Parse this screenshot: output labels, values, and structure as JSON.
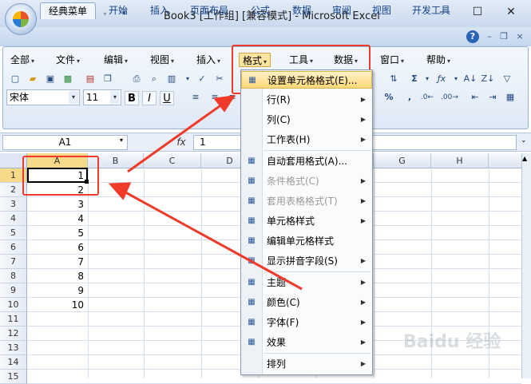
{
  "window": {
    "title": "Book3  [工作组]  [兼容模式] - Microsoft Excel"
  },
  "ribbon_tabs": [
    "经典菜单",
    "开始",
    "插入",
    "页面布局",
    "公式",
    "数据",
    "审阅",
    "视图",
    "开发工具"
  ],
  "classic_menu": {
    "all": "全部",
    "file": "文件",
    "edit": "编辑",
    "view": "视图",
    "insert": "插入",
    "format": "格式",
    "tools": "工具",
    "data": "数据",
    "window": "窗口",
    "help": "帮助"
  },
  "font": {
    "name": "宋体",
    "size": "11"
  },
  "format_buttons": {
    "bold": "B",
    "italic": "I",
    "underline": "U",
    "percent": "%",
    "comma": ","
  },
  "formula_bar": {
    "name_box": "A1",
    "fx_label": "fx",
    "value": "1"
  },
  "columns": [
    "A",
    "B",
    "C",
    "D",
    "E",
    "F",
    "G",
    "H"
  ],
  "rows": [
    "1",
    "2",
    "3",
    "4",
    "5",
    "6",
    "7",
    "8",
    "9",
    "10",
    "11",
    "12",
    "13",
    "14",
    "15"
  ],
  "column_a_values": [
    "1",
    "2",
    "3",
    "4",
    "5",
    "6",
    "7",
    "8",
    "9",
    "10"
  ],
  "format_menu": {
    "items": [
      {
        "label": "设置单元格格式(E)...",
        "icon": "format-cells-icon",
        "submenu": false,
        "disabled": false,
        "highlighted": true
      },
      {
        "label": "行(R)",
        "icon": "",
        "submenu": true,
        "disabled": false
      },
      {
        "label": "列(C)",
        "icon": "",
        "submenu": true,
        "disabled": false
      },
      {
        "label": "工作表(H)",
        "icon": "",
        "submenu": true,
        "disabled": false
      },
      {
        "label": "自动套用格式(A)...",
        "icon": "autoformat-icon",
        "submenu": false,
        "disabled": false
      },
      {
        "label": "条件格式(C)",
        "icon": "conditional-format-icon",
        "submenu": true,
        "disabled": true
      },
      {
        "label": "套用表格格式(T)",
        "icon": "table-format-icon",
        "submenu": true,
        "disabled": true
      },
      {
        "label": "单元格样式",
        "icon": "cell-styles-icon",
        "submenu": true,
        "disabled": false
      },
      {
        "label": "编辑单元格样式",
        "icon": "edit-cell-style-icon",
        "submenu": false,
        "disabled": false
      },
      {
        "label": "显示拼音字段(S)",
        "icon": "phonetic-icon",
        "submenu": true,
        "disabled": false
      },
      {
        "label": "主题",
        "icon": "theme-icon",
        "submenu": true,
        "disabled": false
      },
      {
        "label": "颜色(C)",
        "icon": "colors-icon",
        "submenu": true,
        "disabled": false
      },
      {
        "label": "字体(F)",
        "icon": "fonts-icon",
        "submenu": true,
        "disabled": false
      },
      {
        "label": "效果",
        "icon": "effects-icon",
        "submenu": true,
        "disabled": false
      },
      {
        "label": "排列",
        "icon": "",
        "submenu": true,
        "disabled": false
      }
    ]
  },
  "colors": {
    "annotation_red": "#f03a2a",
    "menu_highlight": "#ffd97a",
    "ribbon_blue": "#c4d6ee"
  },
  "watermark": "Baidu 经验"
}
